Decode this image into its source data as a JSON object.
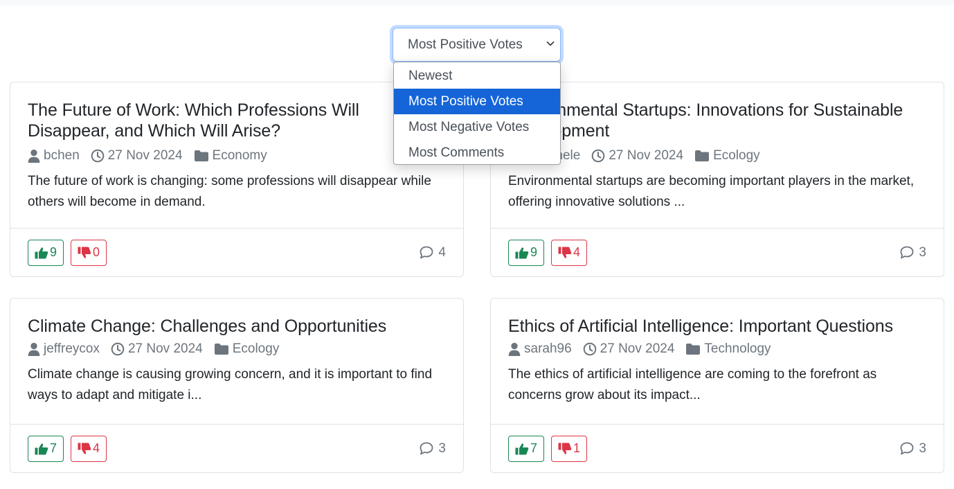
{
  "sort": {
    "selected": "Most Positive Votes",
    "options": [
      "Newest",
      "Most Positive Votes",
      "Most Negative Votes",
      "Most Comments"
    ]
  },
  "posts": [
    {
      "title": "The Future of Work: Which Professions Will Disappear, and Which Will Arise?",
      "author": "bchen",
      "date": "27 Nov 2024",
      "category": "Economy",
      "excerpt": "The future of work is changing: some professions will disappear while others will become in demand.",
      "upvotes": "9",
      "downvotes": "0",
      "comments": "4"
    },
    {
      "title": "Environmental Startups: Innovations for Sustainable Development",
      "author": "mmichele",
      "date": "27 Nov 2024",
      "category": "Ecology",
      "excerpt": "Environmental startups are becoming important players in the market, offering innovative solutions ...",
      "upvotes": "9",
      "downvotes": "4",
      "comments": "3"
    },
    {
      "title": "Climate Change: Challenges and Opportunities",
      "author": "jeffreycox",
      "date": "27 Nov 2024",
      "category": "Ecology",
      "excerpt": "Climate change is causing growing concern, and it is important to find ways to adapt and mitigate i...",
      "upvotes": "7",
      "downvotes": "4",
      "comments": "3"
    },
    {
      "title": "Ethics of Artificial Intelligence: Important Questions",
      "author": "sarah96",
      "date": "27 Nov 2024",
      "category": "Technology",
      "excerpt": "The ethics of artificial intelligence are coming to the forefront as concerns grow about its impact...",
      "upvotes": "7",
      "downvotes": "1",
      "comments": "3"
    }
  ],
  "icons": {
    "author": "user-icon",
    "date": "clock-icon",
    "category": "folder-icon",
    "upvote": "thumbs-up-icon",
    "downvote": "thumbs-down-icon",
    "comments": "chat-bubble-icon"
  },
  "colors": {
    "upvote": "#198754",
    "downvote": "#dc3545",
    "selected_option": "#1565d8",
    "muted": "#6c757d"
  }
}
